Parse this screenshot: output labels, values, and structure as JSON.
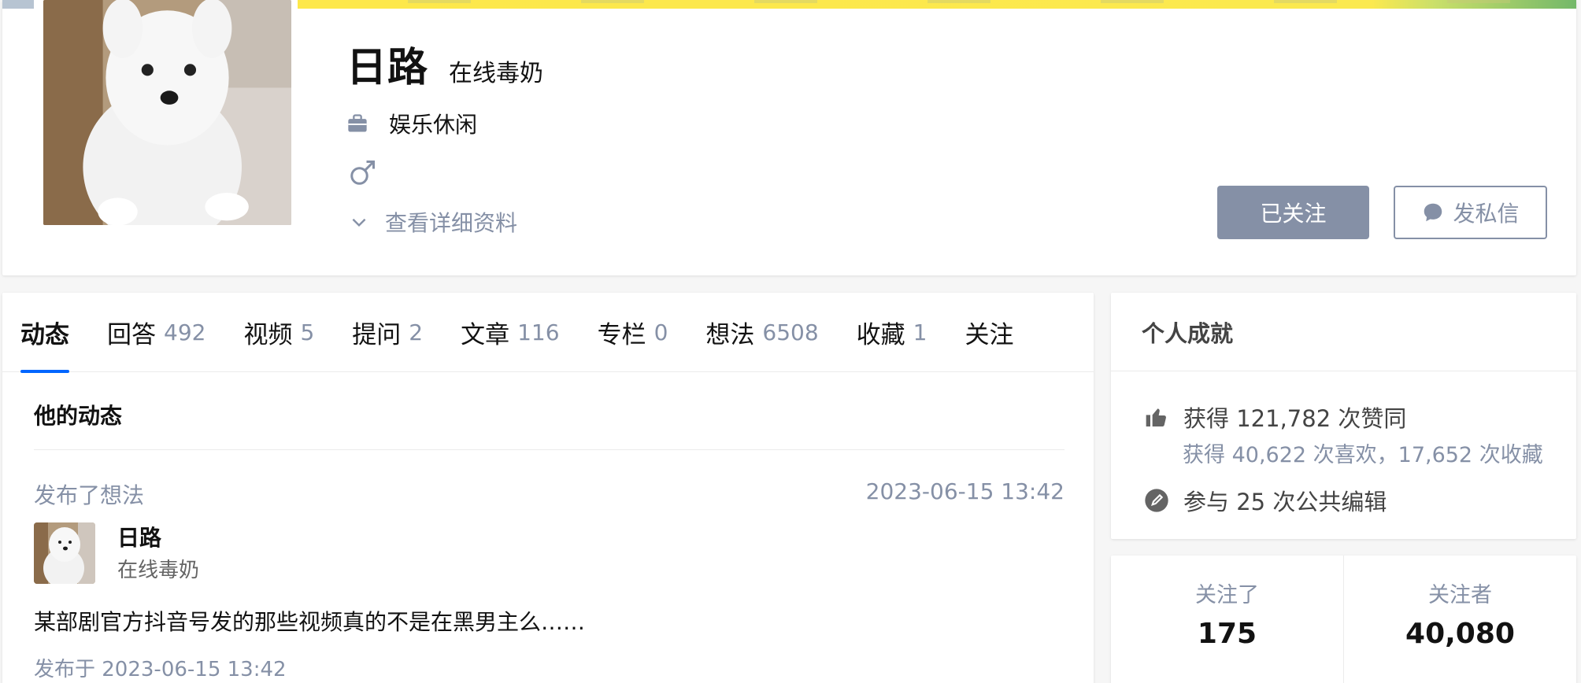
{
  "profile": {
    "name": "日路",
    "headline": "在线毒奶",
    "industry": "娱乐休闲",
    "gender_icon": "male-icon",
    "detail_toggle_label": "查看详细资料",
    "followed_button_label": "已关注",
    "message_button_label": "发私信"
  },
  "tabs": [
    {
      "label": "动态",
      "count": "",
      "active": true
    },
    {
      "label": "回答",
      "count": "492"
    },
    {
      "label": "视频",
      "count": "5"
    },
    {
      "label": "提问",
      "count": "2"
    },
    {
      "label": "文章",
      "count": "116"
    },
    {
      "label": "专栏",
      "count": "0"
    },
    {
      "label": "想法",
      "count": "6508"
    },
    {
      "label": "收藏",
      "count": "1"
    },
    {
      "label": "关注",
      "count": ""
    }
  ],
  "feed": {
    "header": "他的动态",
    "items": [
      {
        "action": "发布了想法",
        "time": "2023-06-15 13:42",
        "author_name": "日路",
        "author_headline": "在线毒奶",
        "content": "某部剧官方抖音号发的那些视频真的不是在黑男主么……",
        "published": "发布于 2023-06-15 13:42"
      }
    ]
  },
  "achievements": {
    "title": "个人成就",
    "likes": "获得 121,782 次赞同",
    "likes_sub": "获得 40,622 次喜欢，17,652 次收藏",
    "edits": "参与 25 次公共编辑"
  },
  "follow_stats": {
    "following_label": "关注了",
    "following_value": "175",
    "followers_label": "关注者",
    "followers_value": "40,080"
  },
  "colors": {
    "accent": "#0066ff",
    "muted": "#8590a6",
    "cover_yellow": "#fde84a",
    "cover_green": "#74b86a"
  }
}
